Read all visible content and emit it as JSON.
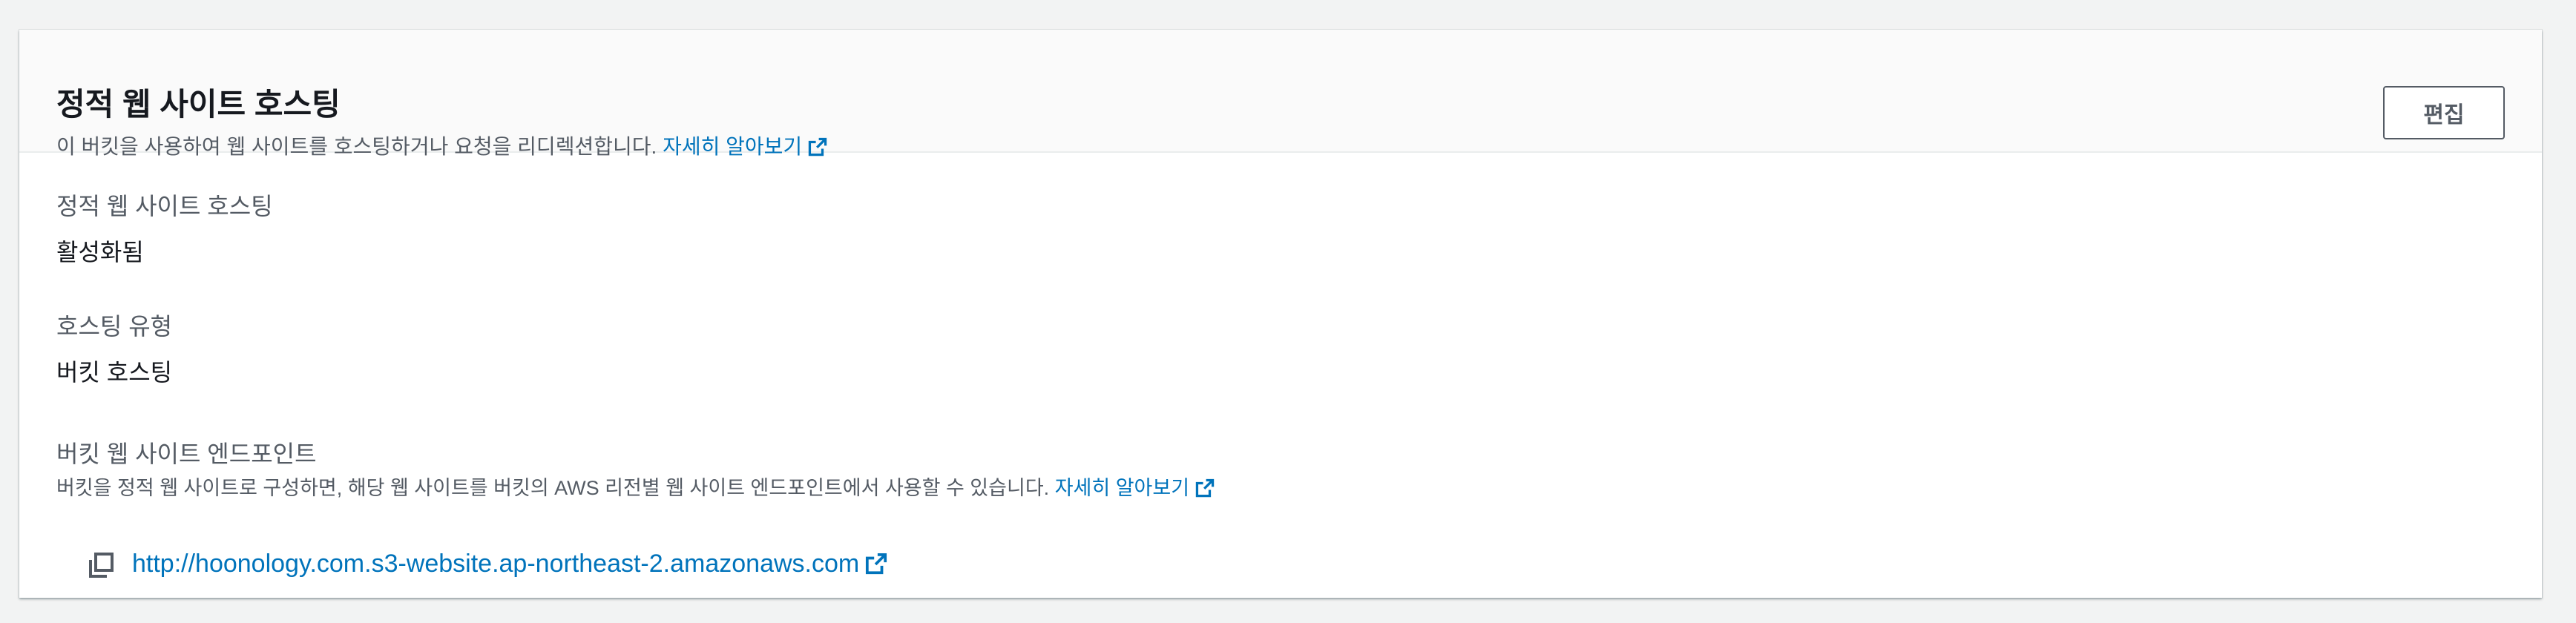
{
  "panel": {
    "title": "정적 웹 사이트 호스팅",
    "description": "이 버킷을 사용하여 웹 사이트를 호스팅하거나 요청을 리디렉션합니다.",
    "learn_more": "자세히 알아보기",
    "edit_button": "편집"
  },
  "fields": {
    "static_hosting": {
      "label": "정적 웹 사이트 호스팅",
      "value": "활성화됨"
    },
    "hosting_type": {
      "label": "호스팅 유형",
      "value": "버킷 호스팅"
    },
    "endpoint": {
      "label": "버킷 웹 사이트 엔드포인트",
      "description": "버킷을 정적 웹 사이트로 구성하면, 해당 웹 사이트를 버킷의 AWS 리전별 웹 사이트 엔드포인트에서 사용할 수 있습니다.",
      "learn_more": "자세히 알아보기",
      "url": "http://hoonology.com.s3-website.ap-northeast-2.amazonaws.com"
    }
  },
  "icons": {
    "external_link": "external-link-icon",
    "copy": "copy-icon"
  },
  "colors": {
    "link": "#0073bb",
    "text_primary": "#16191f",
    "text_secondary": "#545b64",
    "background": "#f2f3f3",
    "header_background": "#fafafa"
  }
}
